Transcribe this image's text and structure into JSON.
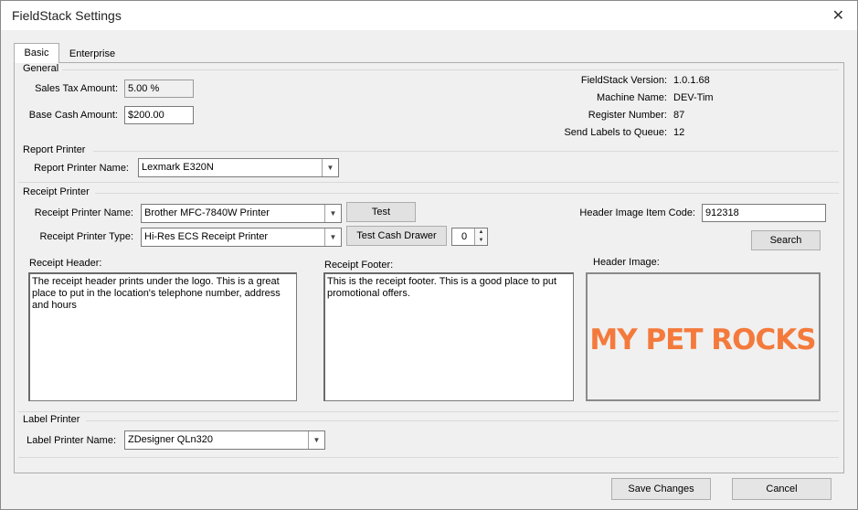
{
  "window": {
    "title": "FieldStack Settings"
  },
  "tabs": [
    {
      "label": "Basic"
    },
    {
      "label": "Enterprise"
    }
  ],
  "general": {
    "title": "General",
    "sales_tax_label": "Sales Tax Amount:",
    "sales_tax_value": "5.00 %",
    "base_cash_label": "Base Cash Amount:",
    "base_cash_value": "$200.00",
    "info": [
      {
        "label": "FieldStack Version:",
        "value": "1.0.1.68"
      },
      {
        "label": "Machine Name:",
        "value": "DEV-Tim"
      },
      {
        "label": "Register Number:",
        "value": "87"
      },
      {
        "label": "Send Labels to Queue:",
        "value": "12"
      }
    ]
  },
  "report_printer": {
    "title": "Report Printer",
    "name_label": "Report Printer Name:",
    "name_value": "Lexmark E320N"
  },
  "receipt_printer": {
    "title": "Receipt Printer",
    "name_label": "Receipt Printer Name:",
    "name_value": "Brother MFC-7840W Printer",
    "test_button": "Test",
    "type_label": "Receipt Printer Type:",
    "type_value": "Hi-Res ECS Receipt Printer",
    "test_cash_drawer_button": "Test Cash Drawer",
    "drawer_number": "0",
    "header_item_code_label": "Header Image Item Code:",
    "header_item_code_value": "912318",
    "search_button": "Search",
    "receipt_header_label": "Receipt Header:",
    "receipt_header_text": "The receipt header prints under the logo.  This is a great place to put in the location's telephone number, address and hours",
    "receipt_footer_label": "Receipt Footer:",
    "receipt_footer_text": "This is the receipt footer.  This is a good place to put promotional offers.",
    "header_image_label": "Header Image:",
    "header_image_logo_text": "MY PET ROCKS"
  },
  "label_printer": {
    "title": "Label Printer",
    "name_label": "Label Printer Name:",
    "name_value": "ZDesigner QLn320"
  },
  "footer": {
    "save_button": "Save Changes",
    "cancel_button": "Cancel"
  },
  "colors": {
    "logo": "#f47a3c",
    "window_bg": "#f0f0f0",
    "border": "#adadad"
  },
  "icons": {
    "close": "close-icon",
    "dropdown": "chevron-down-icon",
    "spin_up": "spin-up-icon",
    "spin_down": "spin-down-icon"
  }
}
